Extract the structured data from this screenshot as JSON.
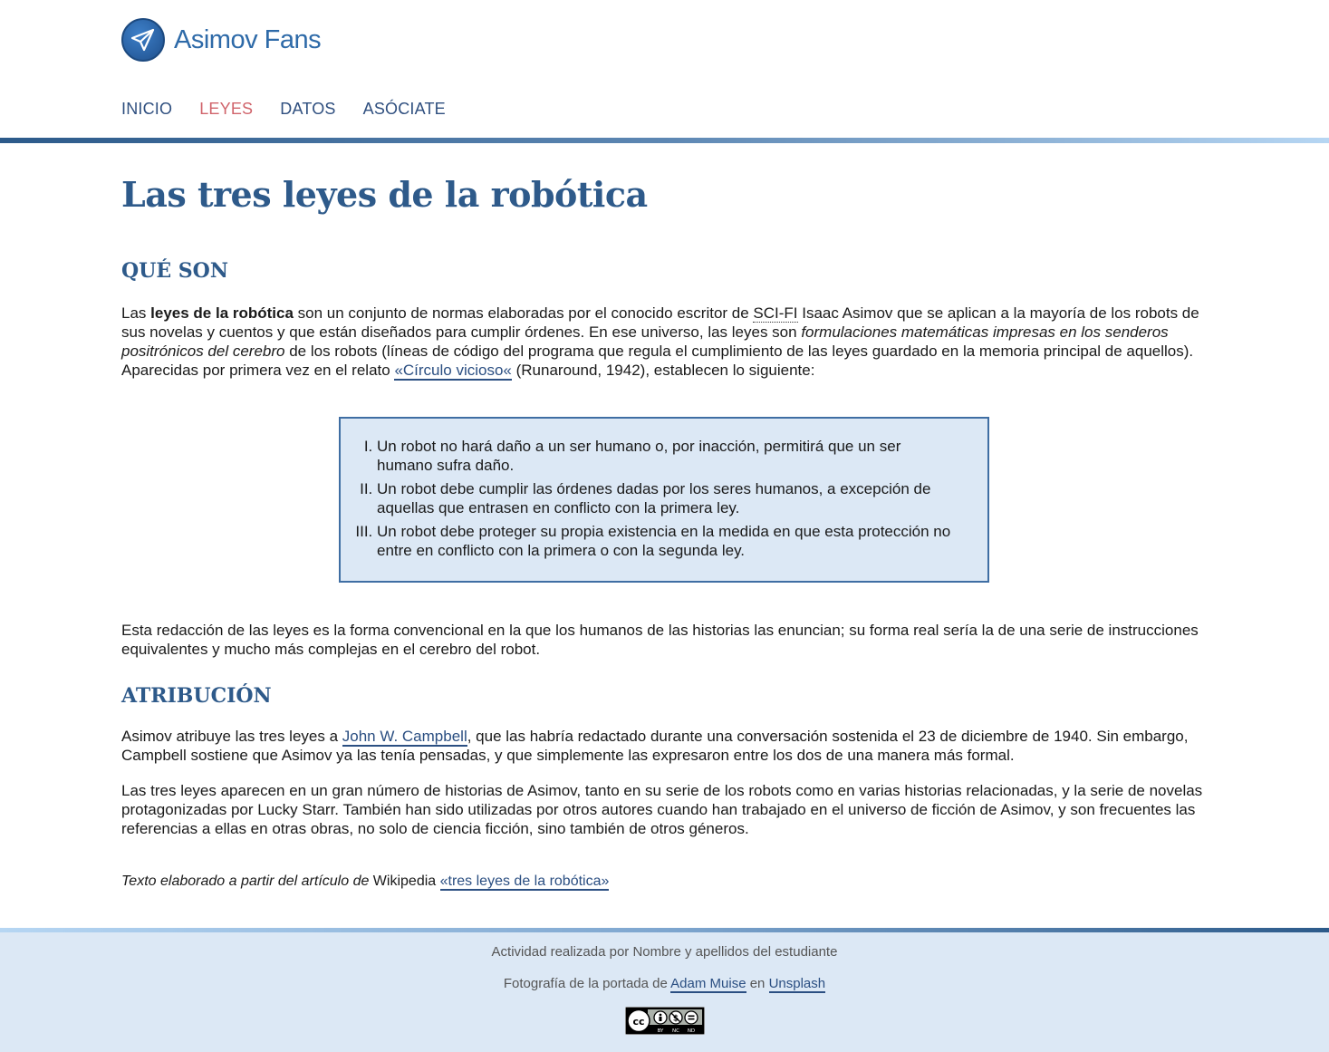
{
  "site": {
    "name": "Asimov Fans"
  },
  "nav": [
    {
      "label": "INICIO",
      "active": false
    },
    {
      "label": "LEYES",
      "active": true
    },
    {
      "label": "DATOS",
      "active": false
    },
    {
      "label": "ASÓCIATE",
      "active": false
    }
  ],
  "article": {
    "title": "Las tres leyes de la robótica",
    "section1_heading": "QUÉ SON",
    "p1": {
      "t1": "Las ",
      "b1": "leyes de la robótica",
      "t2": " son un conjunto de normas elaboradas por el conocido escritor de ",
      "abbr": "SCI-FI",
      "t3": " Isaac Asimov que se aplican a la mayoría de los robots de sus novelas y cuentos y que están diseñados para cumplir órdenes. En ese universo, las leyes son ",
      "em": "formulaciones matemáticas impresas en los senderos positrónicos del cerebro",
      "t4": " de los robots (líneas de código del programa que regula el cumplimiento de las leyes guardado en la memoria principal de aquellos). Aparecidas por primera vez en el relato ",
      "link": "«Círculo vicioso«",
      "t5": " (Runaround, 1942), establecen lo siguiente:"
    },
    "laws": [
      "Un robot no hará daño a un ser humano o, por inacción, permitirá que un ser humano sufra daño.",
      "Un robot debe cumplir las órdenes dadas por los seres humanos, a excepción de aquellas que entrasen en conflicto con la primera ley.",
      "Un robot debe proteger su propia existencia en la medida en que esta protección no entre en conflicto con la primera o con la segunda ley."
    ],
    "p2": "Esta redacción de las leyes es la forma convencional en la que los humanos de las historias las enuncian; su forma real sería la de una serie de instrucciones equivalentes y mucho más complejas en el cerebro del robot.",
    "section2_heading": "ATRIBUCIÓN",
    "p3": {
      "t1": "Asimov atribuye las tres leyes a ",
      "link": "John W. Campbell",
      "t2": ", que las habría redactado durante una conversación sostenida el 23 de diciembre de 1940. Sin embargo, Campbell sostiene que Asimov ya las tenía pensadas, y que simplemente las expresaron entre los dos de una manera más formal."
    },
    "p4": "Las tres leyes aparecen en un gran número de historias de Asimov, tanto en su serie de los robots como en varias historias relacionadas, y la serie de novelas protagonizadas por Lucky Starr. También han sido utilizadas por otros autores cuando han trabajado en el universo de ficción de Asimov, y son frecuentes las referencias a ellas en otras obras, no solo de ciencia ficción, sino también de otros géneros.",
    "credit": {
      "em": "Texto elaborado a partir del artículo de",
      "source": " Wikipedia ",
      "link": "«tres leyes de la robótica»"
    }
  },
  "footer": {
    "author_line": "Actividad realizada por Nombre y apellidos del estudiante",
    "photo_prefix": "Fotografía de la portada de ",
    "photo_author": "Adam Muise",
    "photo_mid": " en ",
    "photo_site": "Unsplash",
    "license_labels": [
      "BY",
      "NC",
      "ND"
    ]
  },
  "colors": {
    "brand": "#2e5a8a",
    "nav_active": "#d0646b",
    "box_bg": "#dce8f5",
    "footer_bg": "#dce8f5"
  },
  "icons": [
    "paper-plane-icon",
    "creative-commons-icon"
  ]
}
